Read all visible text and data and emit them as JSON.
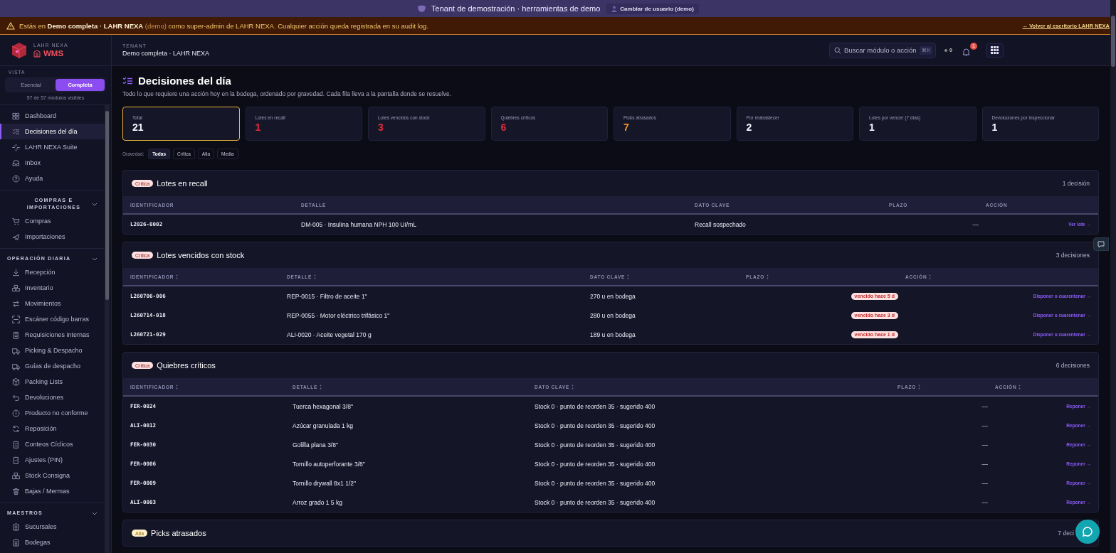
{
  "topbar": {
    "text": "Tenant de demostración · herramientas de demo",
    "button": "Cambiar de usuario (demo)"
  },
  "banner": {
    "lead": "Estás en **Demo completa · LAHR NEXA**",
    "note": "(demo)",
    "rest": "como super-admin de LAHR NEXA. Cualquier acción queda registrada en su audit log.",
    "link": "← Volver al escritorio LAHR NEXA"
  },
  "brand": {
    "company": "LAHR NEXA",
    "product": "WMS"
  },
  "header": {
    "label": "TENANT",
    "tenant": "Demo completa · LAHR NEXA",
    "search_placeholder": "Buscar módulo o acción",
    "shortcut": "⌘K",
    "status": "0",
    "notifications": "1"
  },
  "sidebar": {
    "view_label": "VISTA",
    "views": [
      {
        "label": "Esencial",
        "selected": false
      },
      {
        "label": "Completa",
        "selected": true
      }
    ],
    "modules": "57 de 57 módulos visibles",
    "groups": [
      {
        "items": [
          {
            "label": "Dashboard",
            "selected": false
          },
          {
            "label": "Decisiones del día",
            "selected": true
          },
          {
            "label": "LAHR NEXA Suite",
            "selected": false
          },
          {
            "label": "Inbox",
            "selected": false
          },
          {
            "label": "Ayuda",
            "selected": false
          }
        ]
      },
      {
        "title": "COMPRAS E IMPORTACIONES",
        "expanded": true,
        "items": [
          {
            "label": "Compras",
            "selected": false
          },
          {
            "label": "Importaciones",
            "selected": false
          }
        ]
      },
      {
        "title": "OPERACIÓN DIARIA",
        "expanded": true,
        "items": [
          {
            "label": "Recepción",
            "selected": false
          },
          {
            "label": "Inventario",
            "selected": false
          },
          {
            "label": "Movimientos",
            "selected": false
          },
          {
            "label": "Escáner código barras",
            "selected": false
          },
          {
            "label": "Requisiciones internas",
            "selected": false
          },
          {
            "label": "Picking & Despacho",
            "selected": false
          },
          {
            "label": "Guías de despacho",
            "selected": false
          },
          {
            "label": "Packing Lists",
            "selected": false
          },
          {
            "label": "Devoluciones",
            "selected": false
          },
          {
            "label": "Producto no conforme",
            "selected": false
          },
          {
            "label": "Reposición",
            "selected": false
          },
          {
            "label": "Conteos Cíclicos",
            "selected": false
          },
          {
            "label": "Ajustes (PIN)",
            "selected": false
          },
          {
            "label": "Stock Consigna",
            "selected": false
          },
          {
            "label": "Bajas / Mermas",
            "selected": false
          }
        ]
      },
      {
        "title": "MAESTROS",
        "expanded": true,
        "items": [
          {
            "label": "Sucursales",
            "selected": false
          },
          {
            "label": "Bodegas",
            "selected": false
          }
        ]
      }
    ]
  },
  "page": {
    "title": "Decisiones del día",
    "subtitle": "Todo lo que requiere una acción hoy en la bodega, ordenado por gravedad. Cada fila lleva a la pantalla donde se resuelve."
  },
  "stats": [
    {
      "label": "Total",
      "value": "21",
      "color": "#f5f5ff",
      "selected": true
    },
    {
      "label": "Lotes en recall",
      "value": "1",
      "color": "#e22d3a",
      "selected": false
    },
    {
      "label": "Lotes vencidos con stock",
      "value": "3",
      "color": "#e22d3a",
      "selected": false
    },
    {
      "label": "Quiebres críticos",
      "value": "6",
      "color": "#e22d3a",
      "selected": false
    },
    {
      "label": "Picks atrasados",
      "value": "7",
      "color": "#f5952a",
      "selected": false
    },
    {
      "label": "Por reabastecer",
      "value": "2",
      "color": "#f5f5ff",
      "selected": false
    },
    {
      "label": "Lotes por vencer (7 días)",
      "value": "1",
      "color": "#f5f5ff",
      "selected": false
    },
    {
      "label": "Devoluciones por inspeccionar",
      "value": "1",
      "color": "#f5f5ff",
      "selected": false
    }
  ],
  "filters": {
    "label": "Gravedad:",
    "options": [
      {
        "label": "Todas",
        "selected": true
      },
      {
        "label": "Crítica",
        "selected": false
      },
      {
        "label": "Alta",
        "selected": false
      },
      {
        "label": "Media",
        "selected": false
      }
    ]
  },
  "sections": [
    {
      "color": "#fde0e0",
      "badge": "Crítica",
      "title": "Lotes en recall",
      "count": "1 decisión",
      "sortable": false,
      "columns": [
        "IDENTIFICADOR",
        "DETALLE",
        "DATO CLAVE",
        "PLAZO",
        "ACCIÓN"
      ],
      "rows": [
        {
          "id": "L2026-0002",
          "detail": "DM-005 · Insulina humana NPH 100 UI/mL",
          "key": "Recall sospechado",
          "term": {
            "kind": "plain",
            "text": "—"
          },
          "action": "Ver lote →"
        }
      ]
    },
    {
      "color": "#fde0e0",
      "badge": "Crítica",
      "title": "Lotes vencidos con stock",
      "count": "3 decisiones",
      "sortable": true,
      "columns": [
        "IDENTIFICADOR",
        "DETALLE",
        "DATO CLAVE",
        "PLAZO",
        "ACCIÓN"
      ],
      "rows": [
        {
          "id": "L260706-006",
          "detail": "REP-0015 · Filtro de aceite 1\"",
          "key": "270 u en bodega",
          "term": {
            "kind": "badge",
            "text": "vencido hace 5 d"
          },
          "action": "Disponer o cuarentenar →"
        },
        {
          "id": "L260714-018",
          "detail": "REP-0055 · Motor eléctrico trifásico 1\"",
          "key": "280 u en bodega",
          "term": {
            "kind": "badge",
            "text": "vencido hace 3 d"
          },
          "action": "Disponer o cuarentenar →"
        },
        {
          "id": "L260721-029",
          "detail": "ALI-0020 · Aceite vegetal 170 g",
          "key": "189 u en bodega",
          "term": {
            "kind": "badge",
            "text": "vencido hace 1 d"
          },
          "action": "Disponer o cuarentenar →"
        }
      ]
    },
    {
      "color": "#fde0e0",
      "badge": "Crítica",
      "title": "Quiebres críticos",
      "count": "6 decisiones",
      "sortable": true,
      "columns": [
        "IDENTIFICADOR",
        "DETALLE",
        "DATO CLAVE",
        "PLAZO",
        "ACCIÓN"
      ],
      "rows": [
        {
          "id": "FER-0024",
          "detail": "Tuerca hexagonal 3/8\"",
          "key": "Stock 0 · punto de reorden 35 · sugerido 400",
          "term": {
            "kind": "plain",
            "text": "—"
          },
          "action": "Reponer →"
        },
        {
          "id": "ALI-0012",
          "detail": "Azúcar granulada 1 kg",
          "key": "Stock 0 · punto de reorden 35 · sugerido 400",
          "term": {
            "kind": "plain",
            "text": "—"
          },
          "action": "Reponer →"
        },
        {
          "id": "FER-0030",
          "detail": "Golilla plana 3/8\"",
          "key": "Stock 0 · punto de reorden 35 · sugerido 400",
          "term": {
            "kind": "plain",
            "text": "—"
          },
          "action": "Reponer →"
        },
        {
          "id": "FER-0006",
          "detail": "Tornillo autoperforante 3/8\"",
          "key": "Stock 0 · punto de reorden 35 · sugerido 400",
          "term": {
            "kind": "plain",
            "text": "—"
          },
          "action": "Reponer →"
        },
        {
          "id": "FER-0009",
          "detail": "Tornillo drywall 8x1 1/2\"",
          "key": "Stock 0 · punto de reorden 35 · sugerido 400",
          "term": {
            "kind": "plain",
            "text": "—"
          },
          "action": "Reponer →"
        },
        {
          "id": "ALI-0003",
          "detail": "Arroz grado 1 5 kg",
          "key": "Stock 0 · punto de reorden 35 · sugerido 400",
          "term": {
            "kind": "plain",
            "text": "—"
          },
          "action": "Reponer →"
        }
      ]
    },
    {
      "color": "#fff0c8",
      "badge": "Alta",
      "title": "Picks atrasados",
      "count": "7 deci"
    }
  ]
}
